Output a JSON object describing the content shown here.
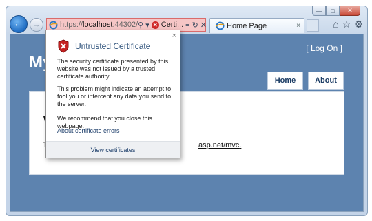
{
  "browser": {
    "address": {
      "url_prefix": "https://",
      "url_host": "localhost",
      "url_suffix": ":44302/",
      "cert_label": "Certi..."
    },
    "tab": {
      "label": "Home Page",
      "close": "×"
    },
    "caption": {
      "minimize": "—",
      "maximize": "□",
      "close": "✕"
    }
  },
  "page": {
    "site_title_partial": "My",
    "logon_open": "[",
    "logon_label": "Log On",
    "logon_close": "]",
    "nav": {
      "home": "Home",
      "about": "About"
    },
    "heading_partial": "W",
    "text_partial": "T",
    "link_partial": "asp.net/mvc",
    "link_trailing": "."
  },
  "popup": {
    "title": "Untrusted Certificate",
    "close": "×",
    "para1": "The security certificate presented by this website was not issued by a trusted certificate authority.",
    "para2": "This problem might indicate an attempt to fool you or intercept any data you send to the server.",
    "para3": "We recommend that you close this webpage.",
    "link": "About certificate errors",
    "footer": "View certificates"
  },
  "colors": {
    "page_background": "#5d83af",
    "address_error": "#f6c6c6",
    "popup_title": "#2b4f79",
    "nav_text": "#1c3d65"
  },
  "icons": [
    "back-arrow-icon",
    "forward-arrow-icon",
    "ie-logo-icon",
    "search-icon",
    "certificate-error-icon",
    "refresh-icon",
    "stop-icon",
    "home-icon",
    "favorites-star-icon",
    "gear-icon",
    "shield-warning-icon"
  ]
}
